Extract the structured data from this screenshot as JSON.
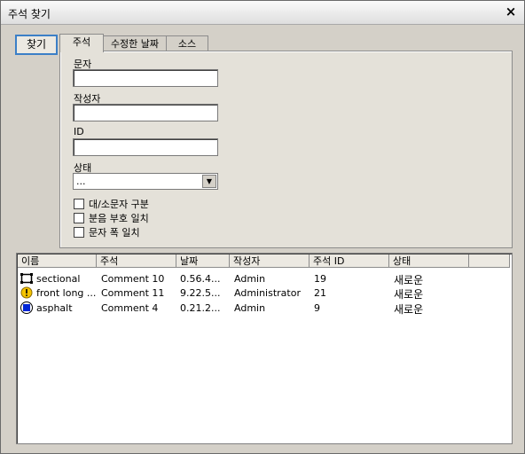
{
  "window": {
    "title": "주석 찾기",
    "close_glyph": "×"
  },
  "find_button": "찾기",
  "tabs": [
    {
      "label": "주석",
      "active": true
    },
    {
      "label": "수정한 날짜",
      "active": false
    },
    {
      "label": "소스",
      "active": false
    }
  ],
  "form": {
    "text_label": "문자",
    "text_value": "",
    "author_label": "작성자",
    "author_value": "",
    "id_label": "ID",
    "id_value": "",
    "status_label": "상태",
    "status_value": "...",
    "checkboxes": [
      {
        "label": "대/소문자 구분",
        "checked": false
      },
      {
        "label": "분음 부호 일치",
        "checked": false
      },
      {
        "label": "문자 폭 일치",
        "checked": false
      }
    ]
  },
  "results": {
    "columns": [
      "이름",
      "주석",
      "날짜",
      "작성자",
      "주석 ID",
      "상태"
    ],
    "rows": [
      {
        "icon": "film-frame-icon",
        "name": "sectional",
        "comment": "Comment 10",
        "date": "0.56.4...",
        "author": "Admin",
        "comment_id": "19",
        "status": "새로운"
      },
      {
        "icon": "warning-icon",
        "name": "front long ...",
        "comment": "Comment 11",
        "date": "9.22.5...",
        "author": "Administrator",
        "comment_id": "21",
        "status": "새로운"
      },
      {
        "icon": "blue-square-icon",
        "name": "asphalt",
        "comment": "Comment 4",
        "date": "0.21.2...",
        "author": "Admin",
        "comment_id": "9",
        "status": "새로운"
      }
    ]
  }
}
